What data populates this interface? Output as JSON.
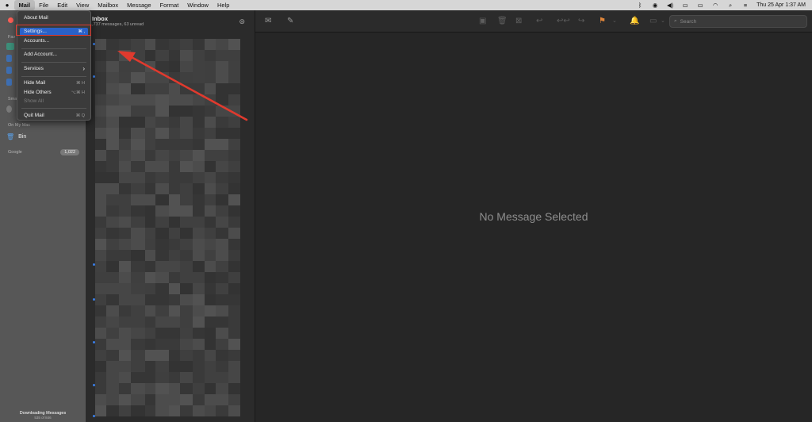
{
  "menubar": {
    "apple": "",
    "items": [
      "Mail",
      "File",
      "Edit",
      "View",
      "Mailbox",
      "Message",
      "Format",
      "Window",
      "Help"
    ],
    "datetime": "Thu 25 Apr  1:37 AM"
  },
  "mail_menu": {
    "items": [
      {
        "label": "About Mail",
        "shortcut": ""
      },
      {
        "label": "Settings...",
        "shortcut": "⌘ ,"
      },
      {
        "label": "Accounts...",
        "shortcut": ""
      },
      {
        "label": "Add Account...",
        "shortcut": ""
      },
      {
        "label": "Services",
        "shortcut": "›"
      },
      {
        "label": "Hide Mail",
        "shortcut": "⌘ H"
      },
      {
        "label": "Hide Others",
        "shortcut": "⌥⌘ H"
      },
      {
        "label": "Show All",
        "shortcut": ""
      },
      {
        "label": "Quit Mail",
        "shortcut": "⌘ Q"
      }
    ]
  },
  "sidebar": {
    "favourites_header": "Fav",
    "smart_header": "Sma",
    "on_my_mac_header": "On My Mac",
    "bin_label": "Bin",
    "google_label": "Google",
    "google_count": "1,022",
    "footer_title": "Downloading Messages",
    "footer_sub": "535 of 846"
  },
  "message_list": {
    "title": "Inbox",
    "subtitle": "1,737 messages, 63 unread"
  },
  "reading_pane": {
    "empty_text": "No Message Selected",
    "search_placeholder": "Search"
  },
  "colors": {
    "highlight": "#2a62c9",
    "annotation": "#e03a2e",
    "flag": "#e0863a",
    "unread_dot": "#3a7ee6"
  }
}
